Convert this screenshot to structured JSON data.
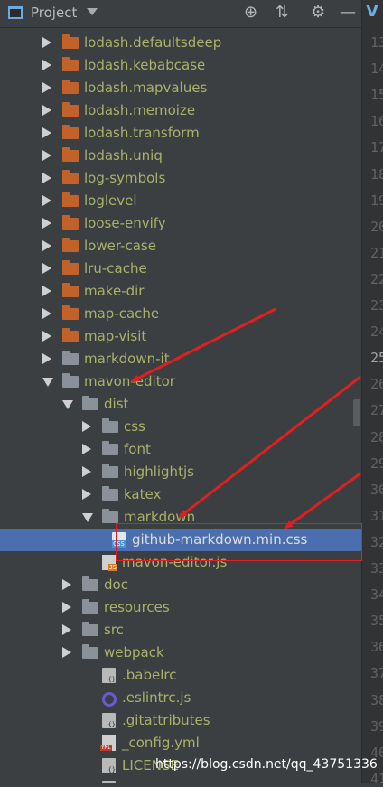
{
  "toolbar": {
    "project_label": "Project",
    "icons": [
      "project-window-icon",
      "dropdown-icon",
      "locate-icon",
      "collapse-all-icon",
      "settings-icon",
      "hide-icon"
    ]
  },
  "tree": [
    {
      "label": "lodash.defaultsdeep",
      "kind": "lib-folder",
      "depth": 0,
      "state": "collapsed"
    },
    {
      "label": "lodash.kebabcase",
      "kind": "lib-folder",
      "depth": 0,
      "state": "collapsed"
    },
    {
      "label": "lodash.mapvalues",
      "kind": "lib-folder",
      "depth": 0,
      "state": "collapsed"
    },
    {
      "label": "lodash.memoize",
      "kind": "lib-folder",
      "depth": 0,
      "state": "collapsed"
    },
    {
      "label": "lodash.transform",
      "kind": "lib-folder",
      "depth": 0,
      "state": "collapsed"
    },
    {
      "label": "lodash.uniq",
      "kind": "lib-folder",
      "depth": 0,
      "state": "collapsed"
    },
    {
      "label": "log-symbols",
      "kind": "lib-folder",
      "depth": 0,
      "state": "collapsed"
    },
    {
      "label": "loglevel",
      "kind": "lib-folder",
      "depth": 0,
      "state": "collapsed"
    },
    {
      "label": "loose-envify",
      "kind": "lib-folder",
      "depth": 0,
      "state": "collapsed"
    },
    {
      "label": "lower-case",
      "kind": "lib-folder",
      "depth": 0,
      "state": "collapsed"
    },
    {
      "label": "lru-cache",
      "kind": "lib-folder",
      "depth": 0,
      "state": "collapsed"
    },
    {
      "label": "make-dir",
      "kind": "lib-folder",
      "depth": 0,
      "state": "collapsed"
    },
    {
      "label": "map-cache",
      "kind": "lib-folder",
      "depth": 0,
      "state": "collapsed"
    },
    {
      "label": "map-visit",
      "kind": "lib-folder",
      "depth": 0,
      "state": "collapsed"
    },
    {
      "label": "markdown-it",
      "kind": "folder",
      "depth": 0,
      "state": "collapsed"
    },
    {
      "label": "mavon-editor",
      "kind": "folder",
      "depth": 0,
      "state": "expanded"
    },
    {
      "label": "dist",
      "kind": "folder",
      "depth": 1,
      "state": "expanded"
    },
    {
      "label": "css",
      "kind": "folder",
      "depth": 2,
      "state": "collapsed"
    },
    {
      "label": "font",
      "kind": "folder",
      "depth": 2,
      "state": "collapsed"
    },
    {
      "label": "highlightjs",
      "kind": "folder",
      "depth": 2,
      "state": "collapsed"
    },
    {
      "label": "katex",
      "kind": "folder",
      "depth": 2,
      "state": "collapsed"
    },
    {
      "label": "markdown",
      "kind": "folder",
      "depth": 2,
      "state": "expanded"
    },
    {
      "label": "github-markdown.min.css",
      "kind": "css",
      "depth": 3,
      "selected": true
    },
    {
      "label": "mavon-editor.js",
      "kind": "js",
      "depth": 2
    },
    {
      "label": "doc",
      "kind": "folder",
      "depth": 1,
      "state": "collapsed"
    },
    {
      "label": "resources",
      "kind": "folder",
      "depth": 1,
      "state": "collapsed"
    },
    {
      "label": "src",
      "kind": "folder",
      "depth": 1,
      "state": "collapsed"
    },
    {
      "label": "webpack",
      "kind": "folder",
      "depth": 1,
      "state": "collapsed"
    },
    {
      "label": ".babelrc",
      "kind": "doc",
      "depth": 1
    },
    {
      "label": ".eslintrc.js",
      "kind": "ring",
      "depth": 1
    },
    {
      "label": ".gitattributes",
      "kind": "doc",
      "depth": 1
    },
    {
      "label": "_config.yml",
      "kind": "yml",
      "depth": 1
    },
    {
      "label": "LICENSE",
      "kind": "doc",
      "depth": 1
    },
    {
      "label": "",
      "kind": "doc",
      "depth": 1
    }
  ],
  "gutter": {
    "tab_letter": "V",
    "line_numbers": [
      "13",
      "14",
      "15",
      "16",
      "17",
      "18",
      "19",
      "20",
      "21",
      "22",
      "23",
      "24",
      "25",
      "26",
      "27",
      "28",
      "29",
      "30",
      "31",
      "32",
      "33",
      "34",
      "35",
      "36",
      "37",
      "38",
      "39",
      "40",
      "41"
    ],
    "current_line": "25"
  },
  "watermark": "https://blog.csdn.net/qq_43751336",
  "colors": {
    "panel_bg": "#3c3f41",
    "selected_row": "#4b6eaf",
    "lib_folder": "#c1622b",
    "folder": "#8a9198",
    "label_text": "#a9b16a",
    "annotation_red": "#e02020"
  }
}
